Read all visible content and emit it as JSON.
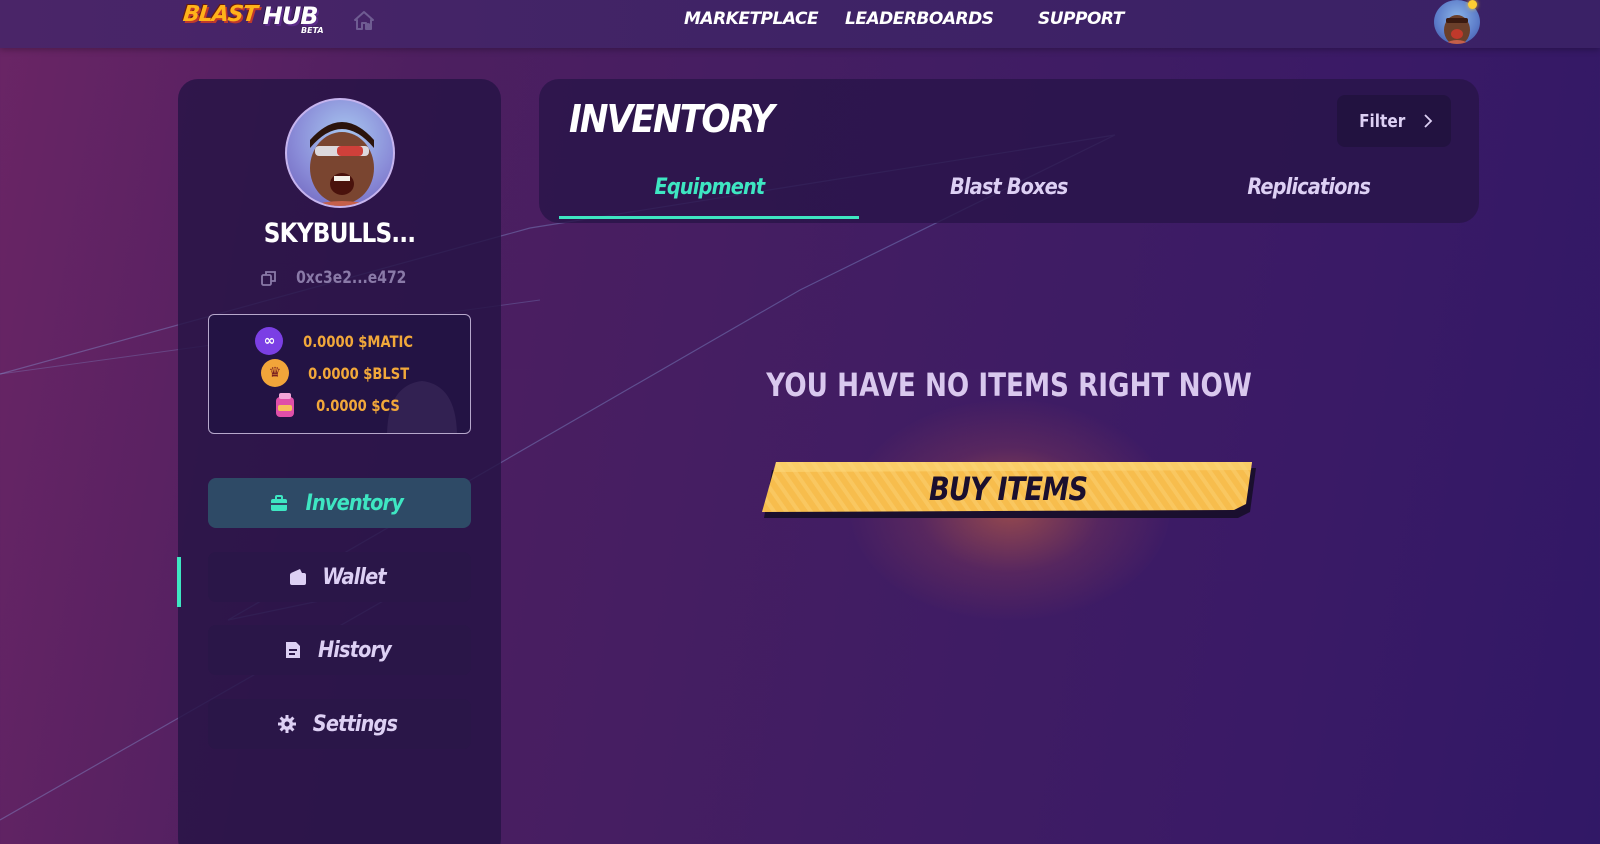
{
  "nav": {
    "logo_primary": "BLAST",
    "logo_secondary": "HUB",
    "logo_badge": "BETA",
    "links": [
      "MARKETPLACE",
      "LEADERBOARDS",
      "SUPPORT"
    ]
  },
  "profile": {
    "username": "SKYBULLS...",
    "address": "0xc3e2...e472"
  },
  "balances": [
    {
      "amount": "0.0000 $MATIC",
      "icon": "matic-coin-icon"
    },
    {
      "amount": "0.0000 $BLST",
      "icon": "blst-coin-icon"
    },
    {
      "amount": "0.0000 $CS",
      "icon": "cs-coin-icon"
    }
  ],
  "sidebar": {
    "items": [
      {
        "label": "Inventory",
        "icon": "briefcase-icon",
        "active": true
      },
      {
        "label": "Wallet",
        "icon": "wallet-icon",
        "active": false
      },
      {
        "label": "History",
        "icon": "document-icon",
        "active": false
      },
      {
        "label": "Settings",
        "icon": "gear-icon",
        "active": false
      }
    ]
  },
  "main": {
    "title": "INVENTORY",
    "filter_label": "Filter",
    "tabs": [
      "Equipment",
      "Blast Boxes",
      "Replications"
    ],
    "active_tab": "Equipment",
    "empty_message": "YOU HAVE NO ITEMS RIGHT NOW",
    "buy_label": "BUY ITEMS"
  },
  "colors": {
    "accent": "#3ee6c2",
    "balance": "#f2a83a",
    "buy_button": "#f7bd4d"
  }
}
